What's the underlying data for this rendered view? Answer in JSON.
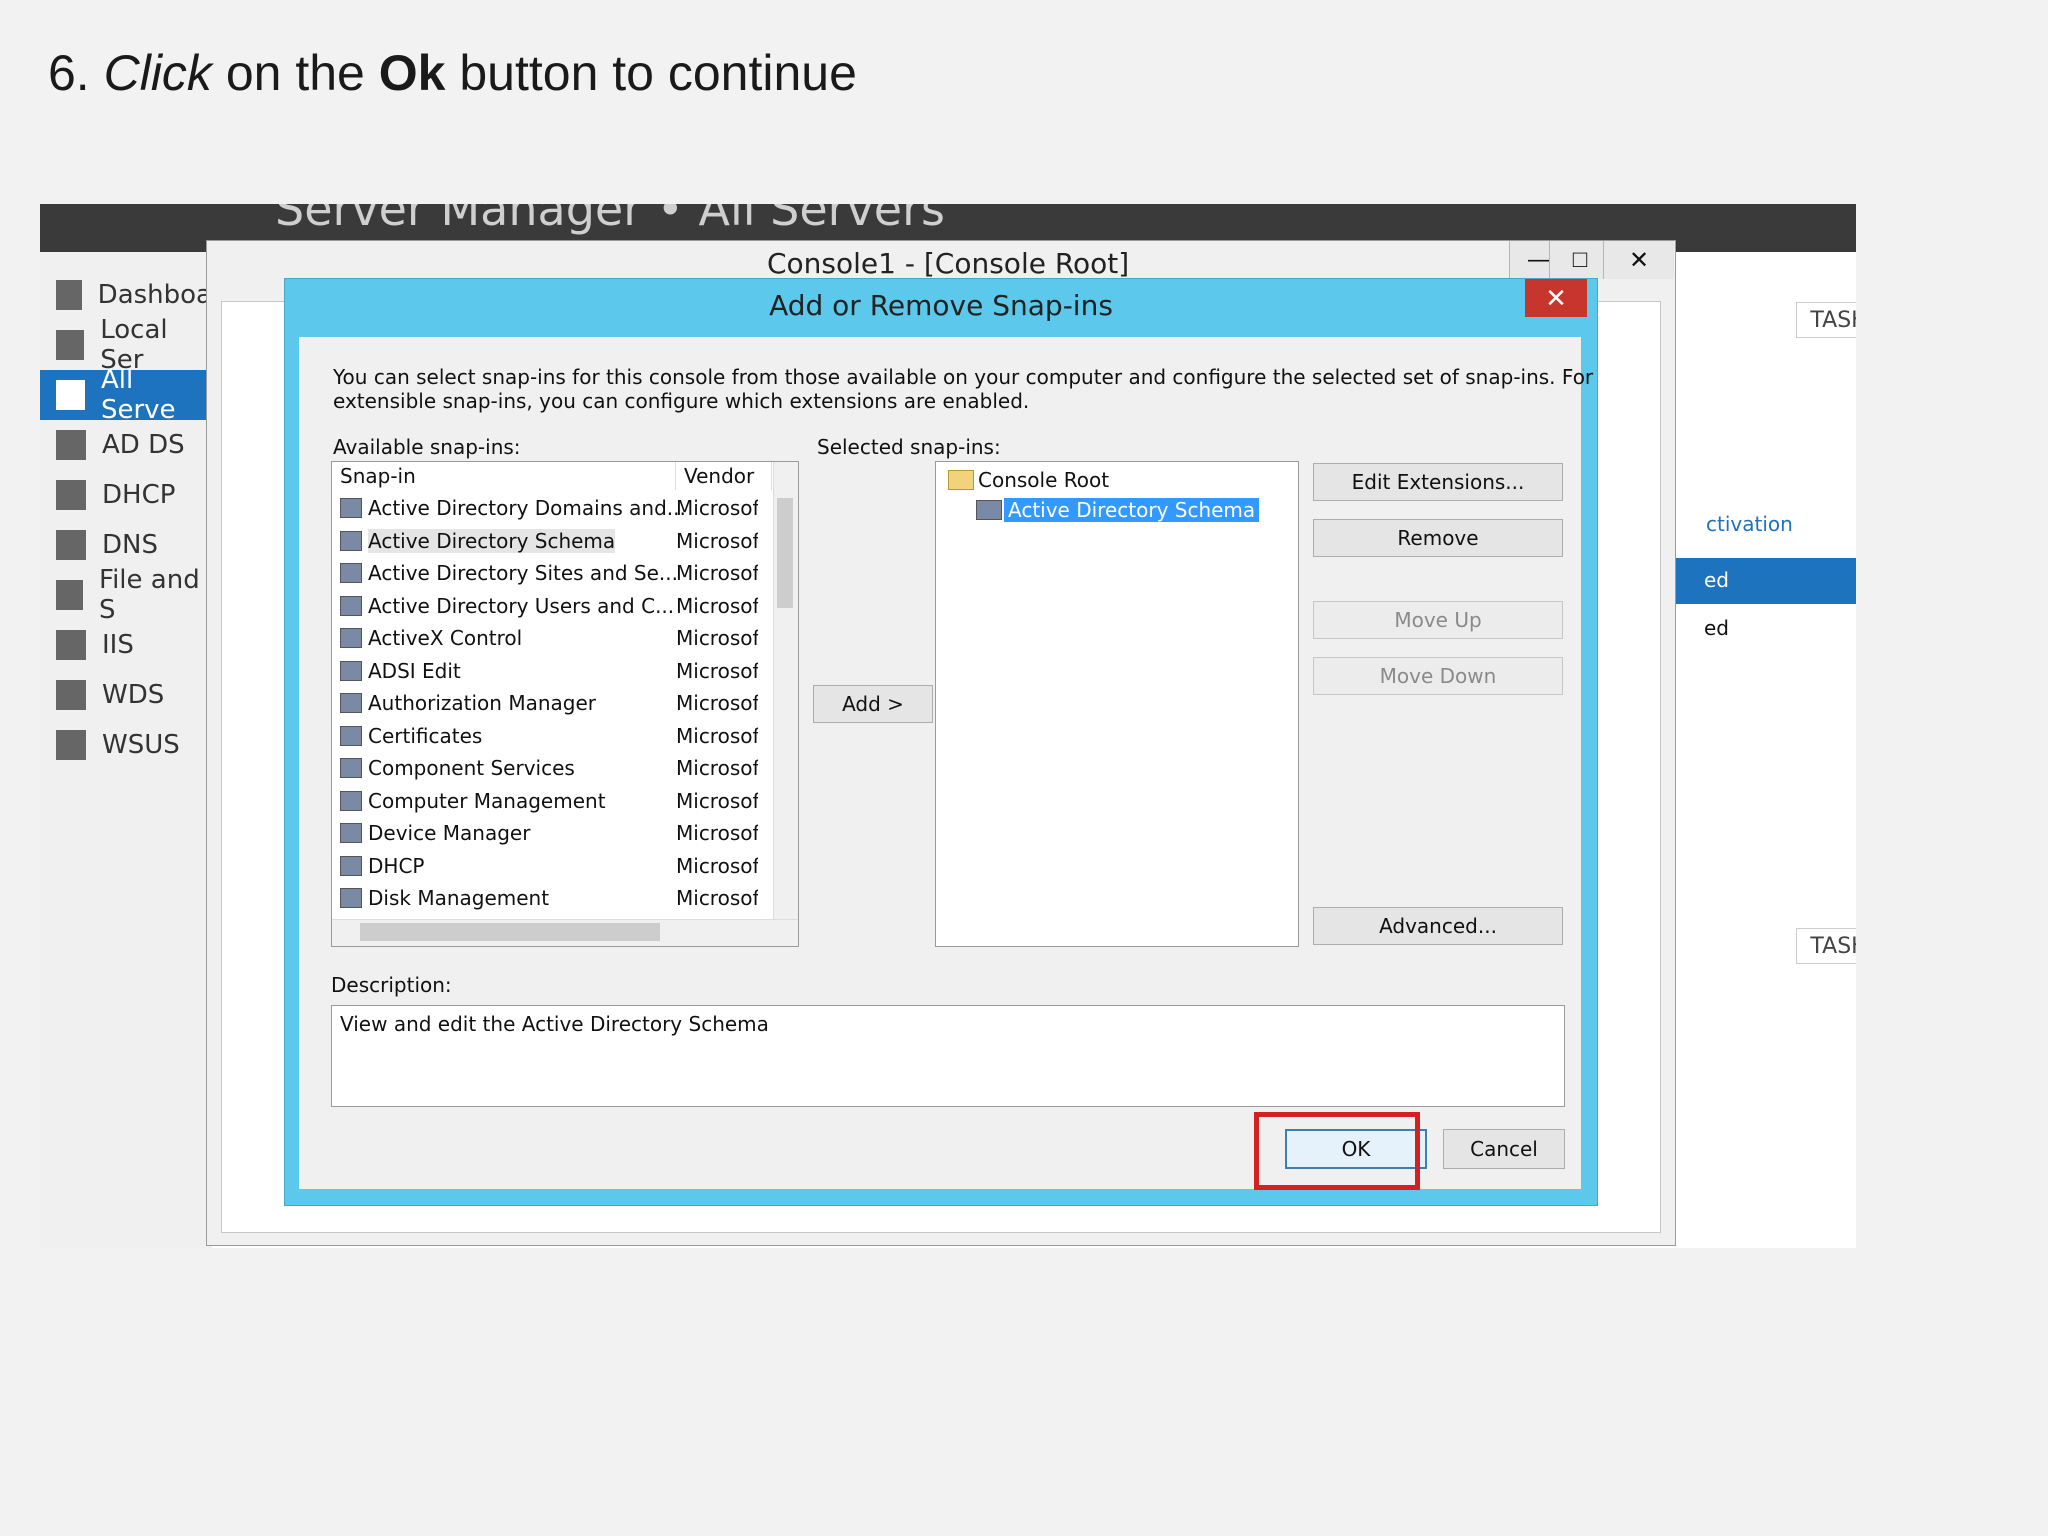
{
  "caption": {
    "num": "6.",
    "click": "Click",
    "mid": "on the",
    "ok": "Ok",
    "rest": "button to continue"
  },
  "server_manager": {
    "title": "Server Manager • All Servers",
    "nav": [
      {
        "label": "Dashboa",
        "icon": "dashboard-icon"
      },
      {
        "label": "Local Ser",
        "icon": "server-icon"
      },
      {
        "label": "All Serve",
        "icon": "servers-icon"
      },
      {
        "label": "AD DS",
        "icon": "ad-ds-icon"
      },
      {
        "label": "DHCP",
        "icon": "dhcp-icon"
      },
      {
        "label": "DNS",
        "icon": "dns-icon"
      },
      {
        "label": "File and S",
        "icon": "file-storage-icon"
      },
      {
        "label": "IIS",
        "icon": "iis-icon"
      },
      {
        "label": "WDS",
        "icon": "wds-icon"
      },
      {
        "label": "WSUS",
        "icon": "wsus-icon"
      }
    ],
    "tasks_label": "TASKS",
    "right_text_1": "ctivation",
    "right_text_2": "ed",
    "right_text_3": "ed"
  },
  "console": {
    "title": "Console1 - [Console Root]",
    "min": "—",
    "max": "□",
    "close": "✕"
  },
  "dialog": {
    "title": "Add or Remove Snap-ins",
    "close": "✕",
    "intro_line1": "You can select snap-ins for this console from those available on your computer and configure the selected set of snap-ins. For",
    "intro_line2": "extensible snap-ins, you can configure which extensions are enabled.",
    "available_label": "Available snap-ins:",
    "selected_label": "Selected snap-ins:",
    "col_snapin": "Snap-in",
    "col_vendor": "Vendor",
    "snapins": [
      {
        "name": "Active Directory Domains and...",
        "vendor": "Microsof"
      },
      {
        "name": "Active Directory Schema",
        "vendor": "Microsof"
      },
      {
        "name": "Active Directory Sites and Se...",
        "vendor": "Microsof"
      },
      {
        "name": "Active Directory Users and C...",
        "vendor": "Microsof"
      },
      {
        "name": "ActiveX Control",
        "vendor": "Microsof"
      },
      {
        "name": "ADSI Edit",
        "vendor": "Microsof"
      },
      {
        "name": "Authorization Manager",
        "vendor": "Microsof"
      },
      {
        "name": "Certificates",
        "vendor": "Microsof"
      },
      {
        "name": "Component Services",
        "vendor": "Microsof"
      },
      {
        "name": "Computer Management",
        "vendor": "Microsof"
      },
      {
        "name": "Device Manager",
        "vendor": "Microsof"
      },
      {
        "name": "DHCP",
        "vendor": "Microsof"
      },
      {
        "name": "Disk Management",
        "vendor": "Microsof"
      }
    ],
    "add_button": "Add >",
    "tree_root": "Console Root",
    "tree_child": "Active Directory Schema",
    "edit_extensions": "Edit Extensions...",
    "remove": "Remove",
    "move_up": "Move Up",
    "move_down": "Move Down",
    "advanced": "Advanced...",
    "description_label": "Description:",
    "description_text": "View and edit the Active Directory Schema",
    "ok": "OK",
    "cancel": "Cancel"
  }
}
